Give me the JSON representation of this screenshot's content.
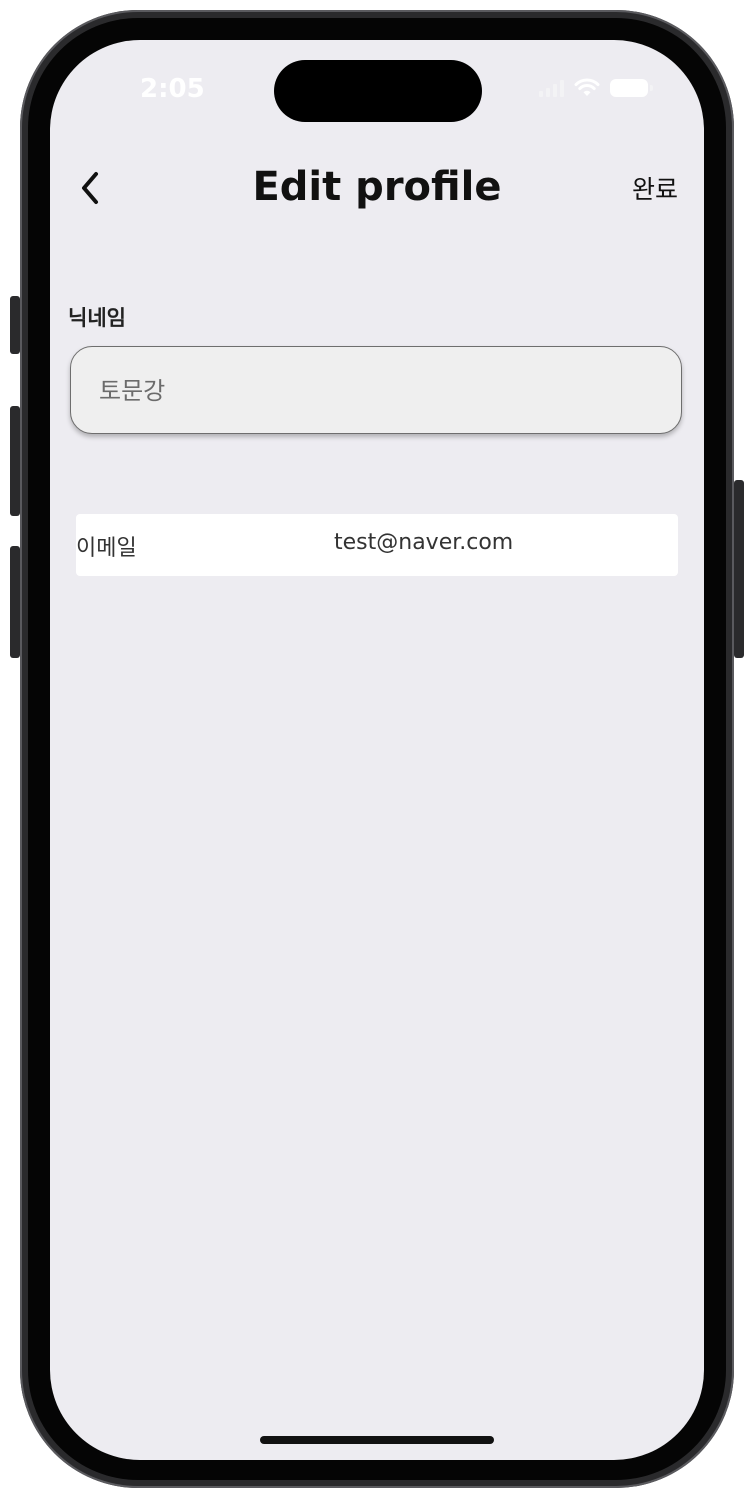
{
  "status_bar": {
    "time": "2:05",
    "icons": [
      "cellular-signal-icon",
      "wifi-icon",
      "battery-icon"
    ]
  },
  "nav": {
    "back_icon": "chevron-left-icon",
    "title": "Edit profile",
    "done_label": "완료"
  },
  "nickname": {
    "label": "닉네임",
    "placeholder": "토문강",
    "value": ""
  },
  "email": {
    "label": "이메일",
    "value": "test@naver.com"
  },
  "colors": {
    "background": "#edecf1",
    "input_bg": "#efefef",
    "row_bg": "#ffffff",
    "text": "#111111"
  }
}
